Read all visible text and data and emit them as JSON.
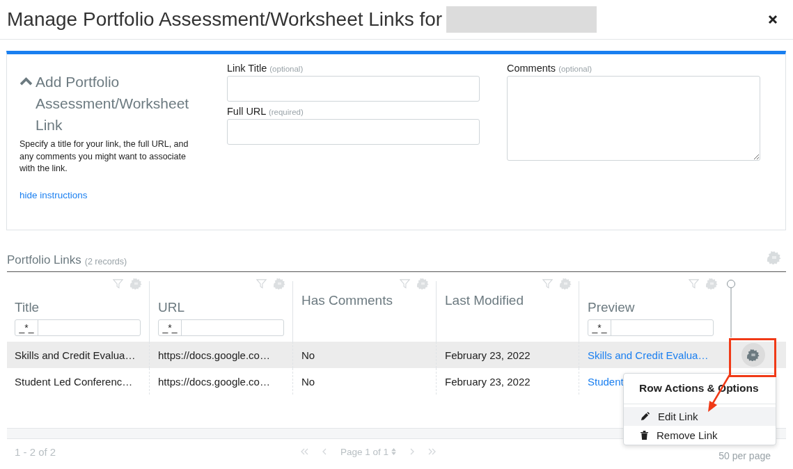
{
  "dialog": {
    "title": "Manage Portfolio Assessment/Worksheet Links for"
  },
  "add_panel": {
    "heading": "Add Portfolio Assessment/Worksheet Link",
    "instructions": "Specify a title for your link, the full URL, and any comments you might want to associate with the link.",
    "toggle_link": "hide instructions",
    "fields": [
      {
        "label": "Link Title",
        "hint": "(optional)",
        "kind": "input"
      },
      {
        "label": "Full URL",
        "hint": "(required)",
        "kind": "input"
      },
      {
        "label": "Comments",
        "hint": "(optional)",
        "kind": "textarea"
      }
    ]
  },
  "table": {
    "title": "Portfolio Links",
    "count": "(2 records)",
    "columns": [
      {
        "label": "Title",
        "filter_prefix": "_*_"
      },
      {
        "label": "URL",
        "filter_prefix": "_*_"
      },
      {
        "label": "Has Comments"
      },
      {
        "label": "Last Modified"
      },
      {
        "label": "Preview",
        "filter_prefix": "_*_"
      }
    ],
    "rows": [
      {
        "selected": true,
        "cells": [
          "Skills and Credit Evalua…",
          "https://docs.google.co…",
          "No",
          "February 23, 2022",
          "Skills and Credit Evalua…"
        ]
      },
      {
        "selected": false,
        "cells": [
          "Student Led Conferenc…",
          "https://docs.google.co…",
          "No",
          "February 23, 2022",
          "Student"
        ]
      }
    ],
    "pagination": {
      "range": "1 - 2 of 2",
      "page": "Page 1 of 1",
      "per_page": "50 per page"
    }
  },
  "row_menu": {
    "title": "Row Actions & Options",
    "items": [
      {
        "label": "Edit Link",
        "selected": true
      },
      {
        "label": "Remove Link",
        "selected": false
      }
    ]
  }
}
